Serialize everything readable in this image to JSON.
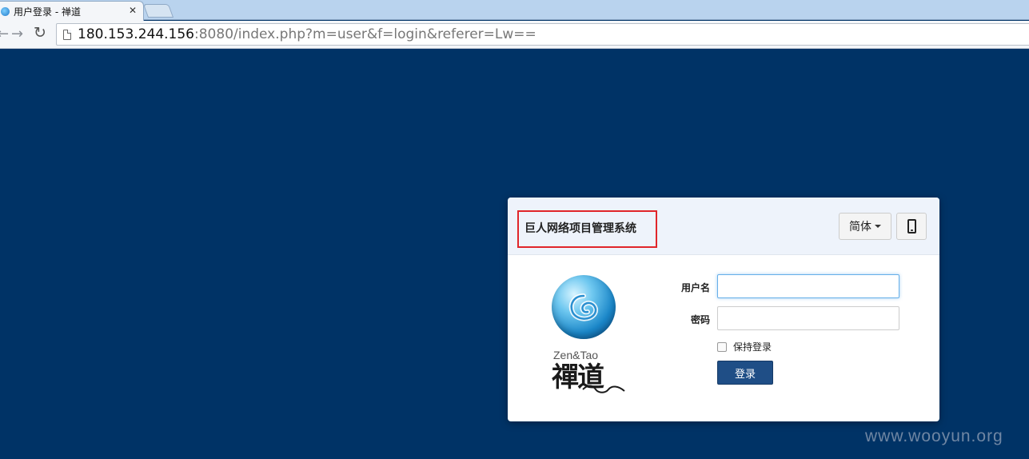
{
  "browser": {
    "tab_title": "用户登录 - 禅道",
    "tab_close": "✕",
    "url_host": "180.153.244.156",
    "url_path": ":8080/index.php?m=user&f=login&referer=Lw=="
  },
  "login": {
    "system_name": "巨人网络项目管理系统",
    "language": "简体",
    "logo_text": "Zen&Tao",
    "logo_calligraphy": "禪道",
    "username_label": "用户名",
    "username_value": "",
    "password_label": "密码",
    "password_value": "",
    "keep_login_label": "保持登录",
    "keep_login_checked": false,
    "submit_label": "登录"
  },
  "watermark": "www.wooyun.org",
  "colors": {
    "background": "#003366",
    "highlight_border": "#e0262a",
    "submit_button": "#1f4e86"
  }
}
